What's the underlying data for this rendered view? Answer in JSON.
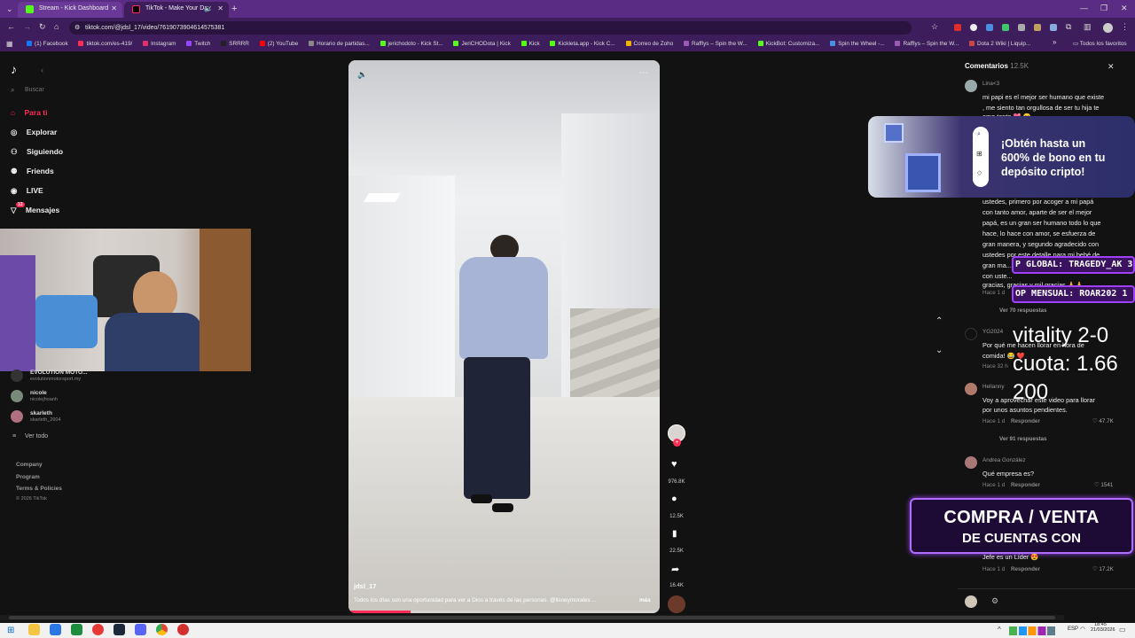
{
  "browser": {
    "tabs": [
      {
        "title": "Stream - Kick Dashboard",
        "active": false
      },
      {
        "title": "TikTok - Make Your Day",
        "active": true
      }
    ],
    "new_tab": "+",
    "url": "tiktok.com/@jdsl_17/video/7619073904614575381",
    "bookmarks": [
      "(1) Facebook",
      "tiktok.com/es-419/",
      "Instagram",
      "Twitch",
      "SRRRR",
      "(2) YouTube",
      "Horario de partidas...",
      "jerichodoto - Kick St...",
      "JeriCHODota | Kick",
      "Kick",
      "Kickleta.app - Kick C...",
      "Correo de Zoho",
      "Rafflys – Spin the W...",
      "KickBot: Customiza...",
      "Spin the Wheel -...",
      "Rafflys – Spin the W...",
      "Dota 2 Wiki | Liquip..."
    ],
    "bookmarks_more": "»",
    "all_favorites": "Todos los favoritos"
  },
  "sidebar": {
    "search_placeholder": "Buscar",
    "items": [
      {
        "label": "Para ti",
        "active": true
      },
      {
        "label": "Explorar"
      },
      {
        "label": "Siguiendo"
      },
      {
        "label": "Friends"
      },
      {
        "label": "LIVE"
      },
      {
        "label": "Mensajes",
        "badge": "13"
      }
    ],
    "following": [
      {
        "name": "EVOLUTION MOTO...",
        "handle": "evolutionmotorsport.my"
      },
      {
        "name": "nicole",
        "handle": "nicolejhoanh"
      },
      {
        "name": "skarleth",
        "handle": "skarleth_2604"
      }
    ],
    "see_all": "Ver todo",
    "footer": [
      "Company",
      "Program",
      "Terms & Policies"
    ],
    "copyright": "© 2026 TikTok"
  },
  "video": {
    "author": "jdsl_17",
    "caption": "Todos los días son una oportunidad para ver a Dios a través de las personas. @lisneymorales ...",
    "more": "más",
    "progress": 0.2
  },
  "actions": {
    "likes": "976.8K",
    "comments": "12.5K",
    "saves": "22.5K",
    "shares": "16.4K"
  },
  "comments": {
    "title": "Comentarios",
    "count": "12.5K",
    "list": [
      {
        "user": "Lina<3",
        "lines": [
          "mi papi es el mejor ser humano que existe",
          ", me siento tan orgullosa de ser tu hija te",
          "amo tanto 💖 😊"
        ]
      },
      {
        "user": "",
        "lines": [
          "ustedes, primero por acoger a mi papá",
          "con tanto amor, aparte de ser el mejor",
          "papá, es un gran ser humano todo lo que",
          "hace, lo hace con amor, se esfuerza de",
          "gran manera, y segundo agradecido con",
          "ustedes por este detalle para mi bebé de",
          "gran ma...",
          "con uste...",
          "gracias, gracias y mil gracias 🙏🙏"
        ],
        "meta": "Hace 1 d",
        "replies": "Ver 70 respuestas"
      },
      {
        "user": "YG2024",
        "lines": [
          "Por qué me hacen llorar en hora de",
          "comida! 😂 ❤️"
        ],
        "meta": "Hace 32 h"
      },
      {
        "user": "Hellanny",
        "lines": [
          "Voy a aprovechar este video para llorar",
          "por unos asuntos pendientes."
        ],
        "meta": "Hace 1 d",
        "reply": "Responder",
        "likes": "47.7K",
        "replies": "Ver 91 respuestas"
      },
      {
        "user": "Andrea González",
        "lines": [
          "Qué empresa es?"
        ],
        "meta": "Hace 1 d",
        "reply": "Responder",
        "likes": "1541"
      },
      {
        "user": "",
        "lines": [
          "Jefe es un Líder 😍"
        ],
        "meta": "Hace 1 d",
        "reply": "Responder",
        "likes": "17.2K"
      }
    ]
  },
  "overlays": {
    "promo_text": "¡Obtén hasta un 600% de bono en tu depósito cripto!",
    "global_top": "P GLOBAL: TRAGEDY_AK 3",
    "monthly_top": "OP MENSUAL: ROAR202 1",
    "bet_line1": "vitality 2-0",
    "bet_line2": "cuota: 1.66",
    "bet_line3": "200",
    "banner_line1": "COMPRA / VENTA",
    "banner_line2": "DE CUENTAS CON"
  },
  "taskbar": {
    "lang": "ESP",
    "time": "18:45",
    "date": "21/03/2026"
  }
}
